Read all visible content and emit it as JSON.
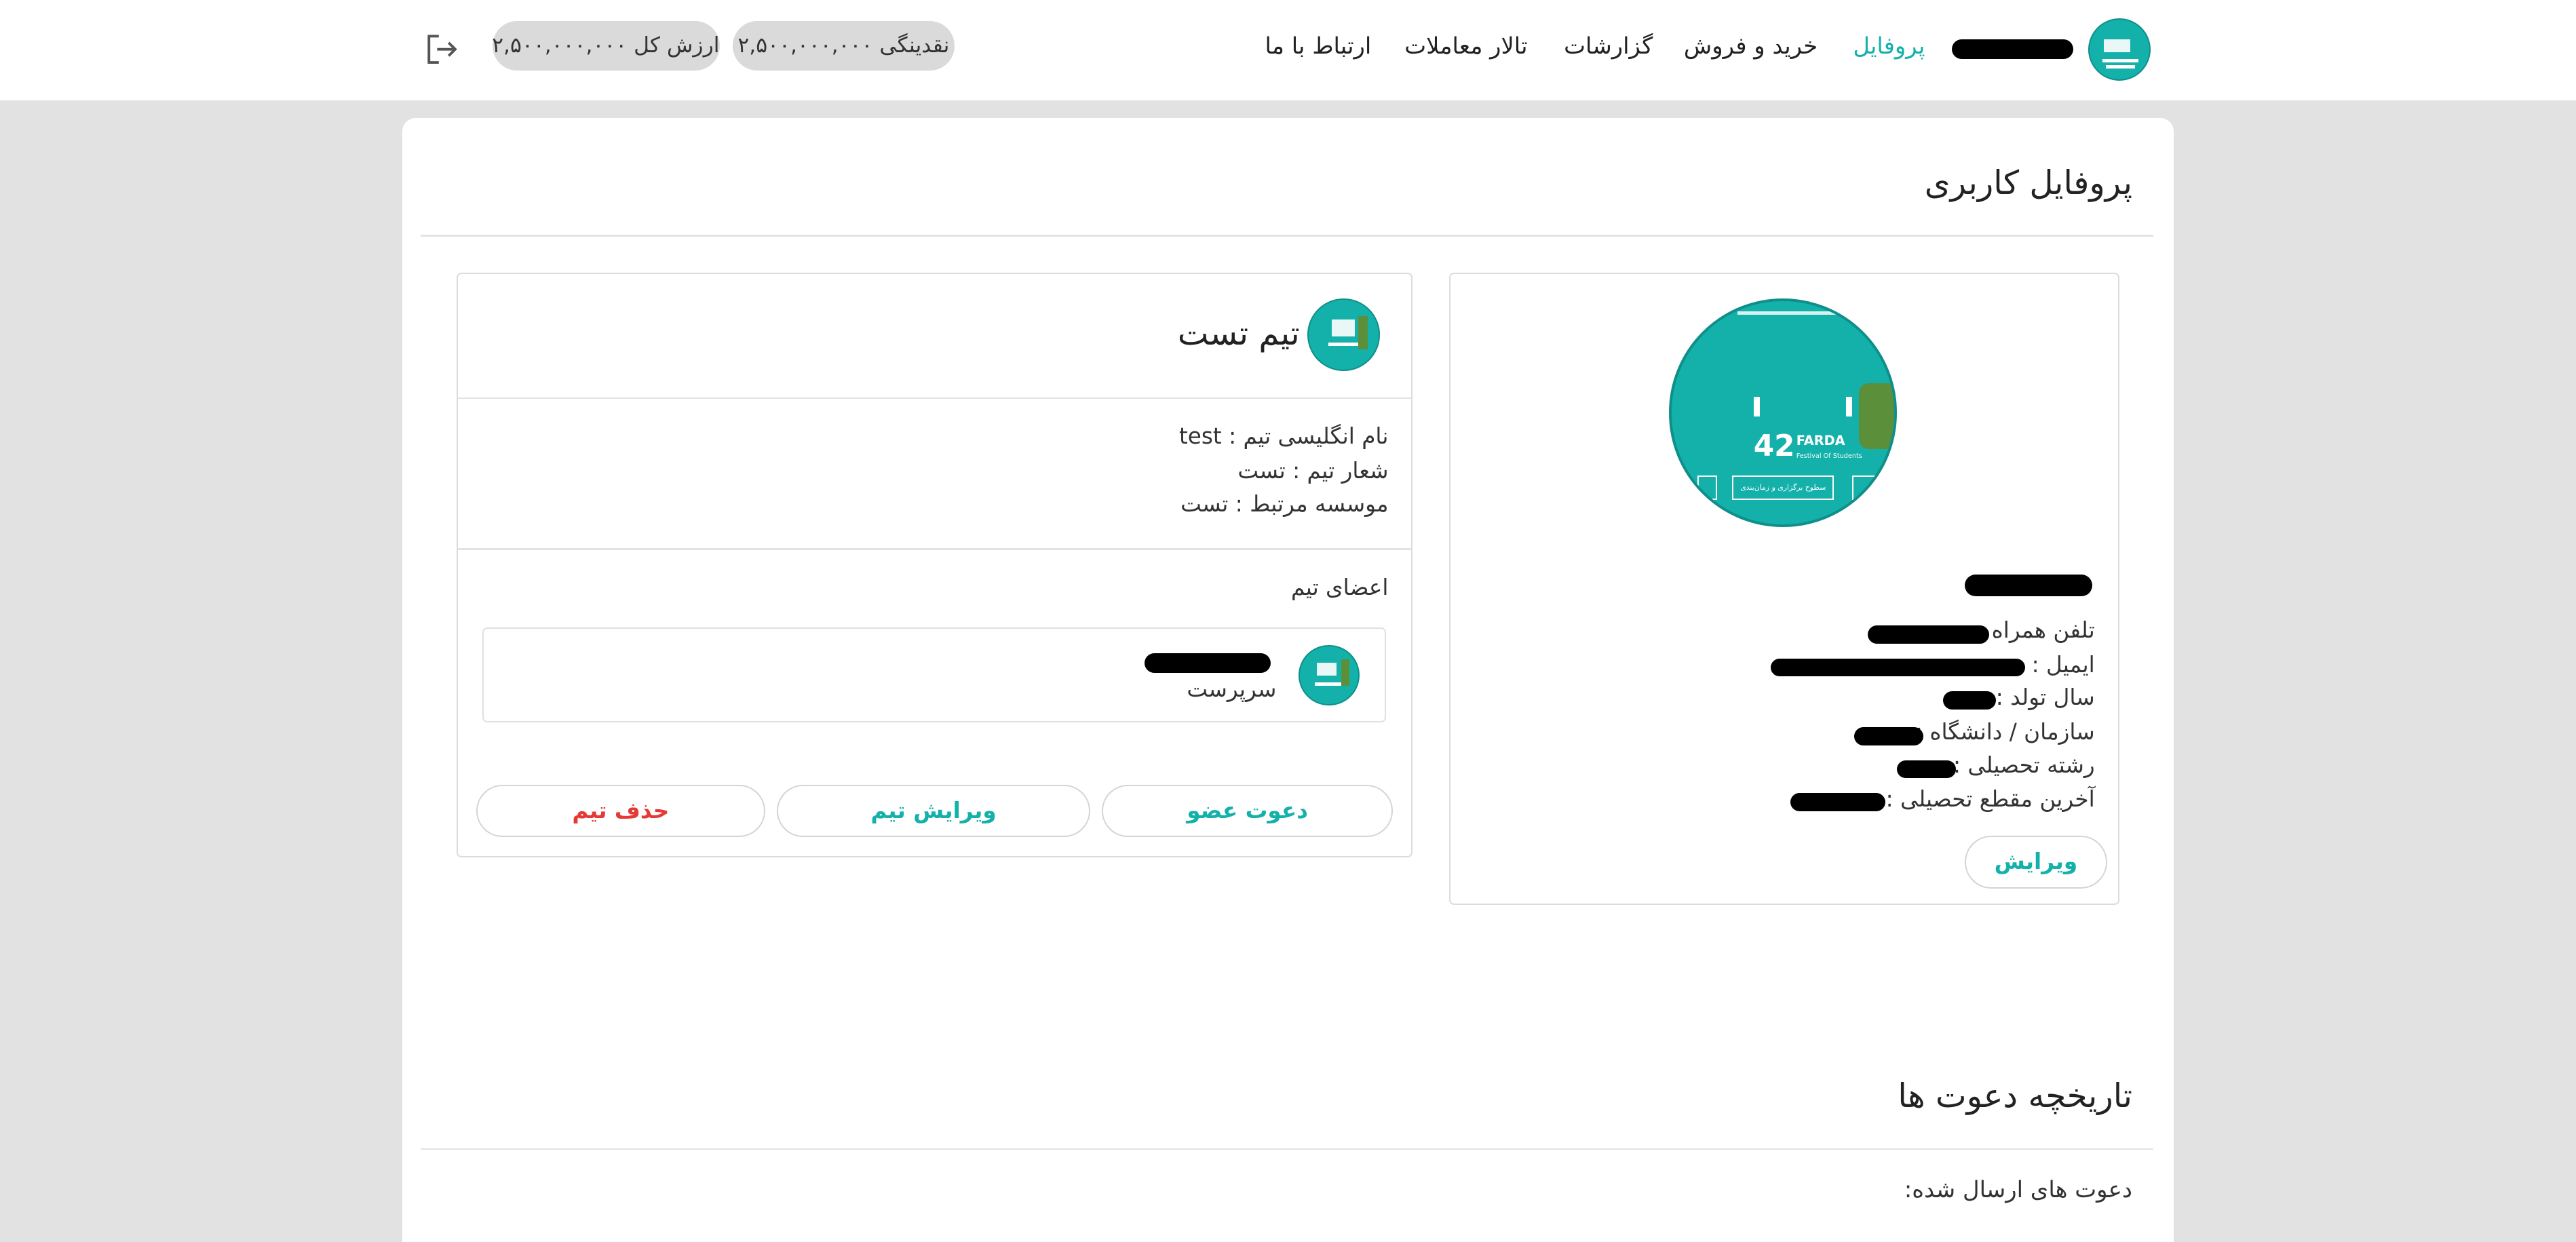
{
  "header": {
    "nav": [
      {
        "label": "پروفایل",
        "active": true
      },
      {
        "label": "خرید و فروش",
        "active": false
      },
      {
        "label": "گزارشات",
        "active": false
      },
      {
        "label": "تالار معاملات",
        "active": false
      },
      {
        "label": "ارتباط با ما",
        "active": false
      }
    ],
    "cash_pill": "نقدینگی ۲,۵۰۰,۰۰۰,۰۰۰",
    "total_pill": "ارزش کل ۲,۵۰۰,۰۰۰,۰۰۰",
    "logout_icon": "logout-icon",
    "username": "[redacted]"
  },
  "page": {
    "title": "پروفایل کاربری"
  },
  "profile": {
    "name": "[redacted]",
    "fields": [
      {
        "label": "تلفن همراه :",
        "value": "[redacted]"
      },
      {
        "label": "ایمیل :",
        "value": "[redacted]"
      },
      {
        "label": "سال تولد :",
        "value": "[redacted]"
      },
      {
        "label": "سازمان / دانشگاه :",
        "value": "[redacted]"
      },
      {
        "label": "رشته تحصیلی :",
        "value": "[redacted]"
      },
      {
        "label": "آخرین مقطع تحصیلی :",
        "value": "[redacted]"
      }
    ],
    "edit_button": "ویرایش",
    "avatar_text": {
      "number": "42",
      "brand": "FARDA",
      "subtitle": "Festival Of Students",
      "badge": "سطوح برگزاری و زمان‌بندی"
    }
  },
  "team": {
    "name": "تیم تست",
    "info": [
      "نام انگلیسی تیم : test",
      "شعار تیم : تست",
      "موسسه مرتبط : تست"
    ],
    "members_title": "اعضای تیم",
    "members": [
      {
        "name": "[redacted]",
        "role": "سرپرست"
      }
    ],
    "buttons": {
      "invite": "دعوت عضو",
      "edit": "ویرایش تیم",
      "delete": "حذف تیم"
    }
  },
  "invites": {
    "title": "تاریخچه دعوت ها",
    "sent_label": "دعوت های ارسال شده:"
  },
  "colors": {
    "accent": "#14b1ab",
    "danger": "#e53935",
    "background": "#e2e2e2"
  }
}
